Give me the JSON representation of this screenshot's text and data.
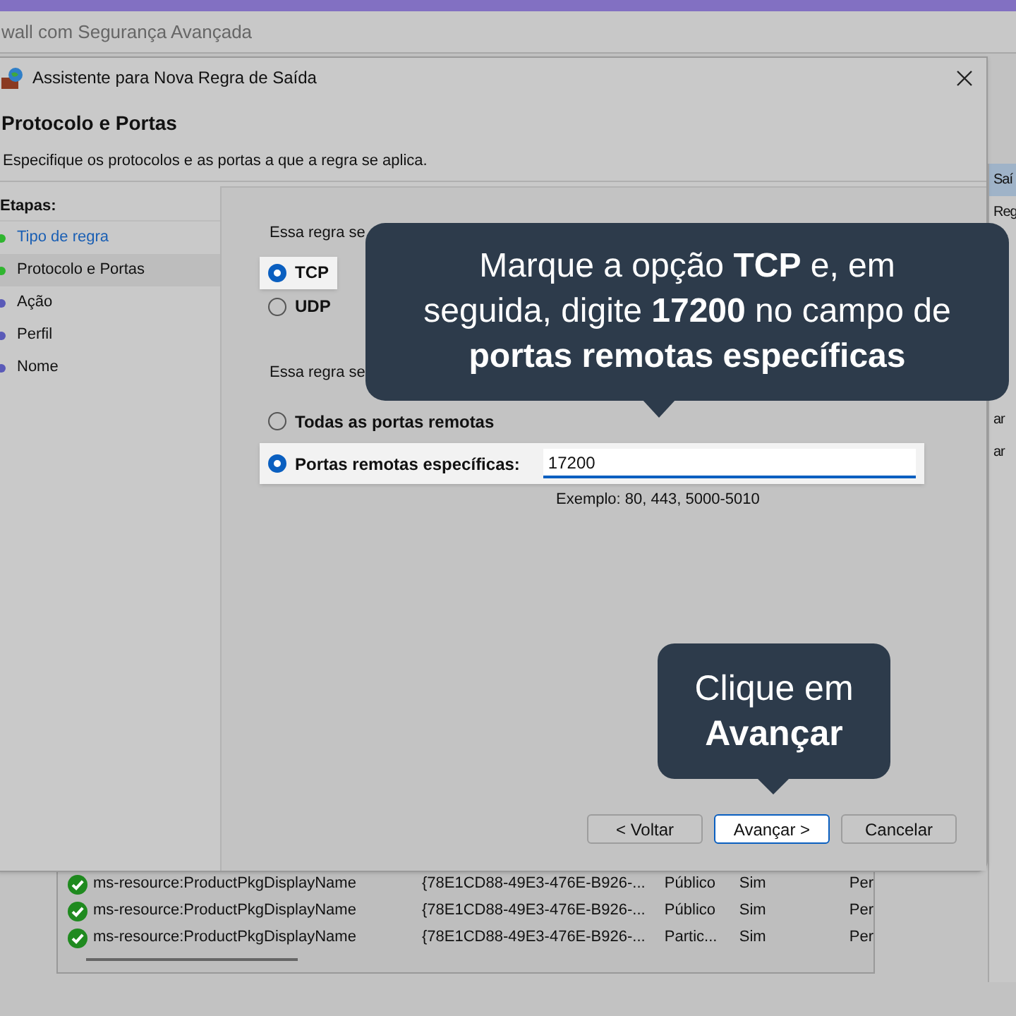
{
  "main_window": {
    "title": "wall com Segurança Avançada"
  },
  "right_pane": {
    "items": [
      {
        "text": "Saí",
        "selected": true
      },
      {
        "text": "Reg",
        "selected": false
      },
      {
        "text": "ar",
        "selected": false
      },
      {
        "text": "ar",
        "selected": false
      }
    ]
  },
  "table": {
    "rows": [
      {
        "name": "ms-resource:ProductPkgDisplayName",
        "group": "{78E1CD88-49E3-476E-B926-...",
        "profile": "Público",
        "enabled": "Sim",
        "column_5": "Per"
      },
      {
        "name": "ms-resource:ProductPkgDisplayName",
        "group": "{78E1CD88-49E3-476E-B926-...",
        "profile": "Público",
        "enabled": "Sim",
        "column_5": "Per"
      },
      {
        "name": "ms-resource:ProductPkgDisplayName",
        "group": "{78E1CD88-49E3-476E-B926-...",
        "profile": "Partic...",
        "enabled": "Sim",
        "column_5": "Per"
      }
    ]
  },
  "dialog": {
    "title": "Assistente para Nova Regra de Saída",
    "heading": "Protocolo e Portas",
    "subtitle": "Especifique os protocolos e as portas a que a regra se aplica.",
    "steps_label": "Etapas:",
    "steps": [
      {
        "label": "Tipo de regra",
        "color": "#2fb52f",
        "selected": false,
        "visited": true
      },
      {
        "label": "Protocolo e Portas",
        "color": "#2fb52f",
        "selected": true,
        "visited": false
      },
      {
        "label": "Ação",
        "color": "#5a5ab8",
        "selected": false,
        "visited": false
      },
      {
        "label": "Perfil",
        "color": "#5a5ab8",
        "selected": false,
        "visited": false
      },
      {
        "label": "Nome",
        "color": "#5a5ab8",
        "selected": false,
        "visited": false
      }
    ],
    "protocol_question": "Essa regra se",
    "protocols": [
      {
        "label": "TCP",
        "selected": true
      },
      {
        "label": "UDP",
        "selected": false
      }
    ],
    "ports_question": "Essa regra se",
    "ports": [
      {
        "label": "Todas as portas remotas",
        "selected": false
      },
      {
        "label": "Portas remotas específicas:",
        "selected": true
      }
    ],
    "port_value": "17200",
    "port_example": "Exemplo: 80, 443, 5000-5010",
    "buttons": [
      {
        "label": "< Voltar",
        "highlighted": false
      },
      {
        "label": "Avançar >",
        "highlighted": true
      },
      {
        "label": "Cancelar",
        "highlighted": false
      }
    ]
  },
  "callouts": [
    {
      "text": "Marque a opção **TCP** e, em seguida, digite **17200** no campo de **portas remotas específicas**"
    },
    {
      "text": "Clique em **Avançar**"
    }
  ]
}
